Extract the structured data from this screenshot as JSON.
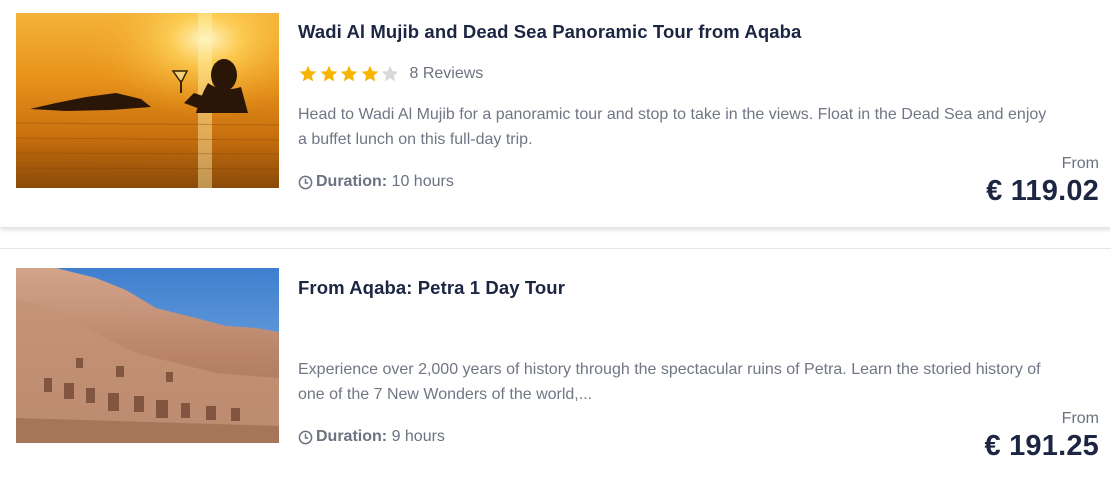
{
  "tours": [
    {
      "title": "Wadi Al Mujib and Dead Sea Panoramic Tour from Aqaba",
      "rating": 4,
      "rating_max": 5,
      "reviews": "8 Reviews",
      "description": "Head to Wadi Al Mujib for a panoramic tour and stop to take in the views. Float in the Dead Sea and enjoy a buffet lunch on this full-day trip.",
      "duration_label": "Duration:",
      "duration_value": "10 hours",
      "from_label": "From",
      "price": "€ 119.02"
    },
    {
      "title": "From Aqaba: Petra 1 Day Tour",
      "description": "Experience over 2,000 years of history through the spectacular ruins of Petra. Learn the storied history of one of the 7 New Wonders of the world,...",
      "duration_label": "Duration:",
      "duration_value": "9 hours",
      "from_label": "From",
      "price": "€ 191.25"
    }
  ],
  "colors": {
    "title": "#1c2541",
    "star_filled": "#f7b500",
    "star_empty": "#d9d9d9",
    "text_muted": "#707683"
  }
}
